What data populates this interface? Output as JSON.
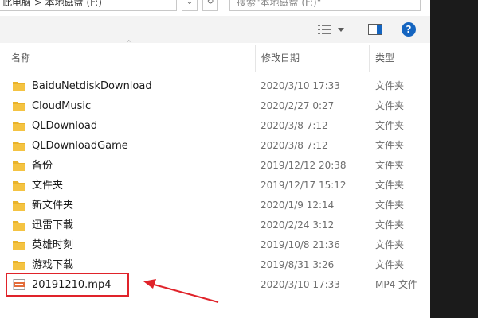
{
  "address": {
    "path": "此电脑 > 本地磁盘 (F:)"
  },
  "search": {
    "placeholder": "搜索\"本地磁盘 (F:)\""
  },
  "toolbar": {
    "help_label": "?"
  },
  "columns": {
    "name": "名称",
    "date": "修改日期",
    "type": "类型"
  },
  "icons": {
    "folder": "folder-icon",
    "file": "mp4-file-icon",
    "view": "view-details-icon",
    "preview": "preview-pane-icon",
    "help": "help-icon"
  },
  "colors": {
    "folder": "#f4c342",
    "accent": "#1565c0",
    "highlight": "#e0232a"
  },
  "files": [
    {
      "name": "BaiduNetdiskDownload",
      "date": "2020/3/10 17:33",
      "type": "文件夹",
      "kind": "folder"
    },
    {
      "name": "CloudMusic",
      "date": "2020/2/27 0:27",
      "type": "文件夹",
      "kind": "folder"
    },
    {
      "name": "QLDownload",
      "date": "2020/3/8 7:12",
      "type": "文件夹",
      "kind": "folder"
    },
    {
      "name": "QLDownloadGame",
      "date": "2020/3/8 7:12",
      "type": "文件夹",
      "kind": "folder"
    },
    {
      "name": "备份",
      "date": "2019/12/12 20:38",
      "type": "文件夹",
      "kind": "folder"
    },
    {
      "name": "文件夹",
      "date": "2019/12/17 15:12",
      "type": "文件夹",
      "kind": "folder"
    },
    {
      "name": "新文件夹",
      "date": "2020/1/9 12:14",
      "type": "文件夹",
      "kind": "folder"
    },
    {
      "name": "迅雷下载",
      "date": "2020/2/24 3:12",
      "type": "文件夹",
      "kind": "folder"
    },
    {
      "name": "英雄时刻",
      "date": "2019/10/8 21:36",
      "type": "文件夹",
      "kind": "folder"
    },
    {
      "name": "游戏下载",
      "date": "2019/8/31 3:26",
      "type": "文件夹",
      "kind": "folder"
    },
    {
      "name": "20191210.mp4",
      "date": "2020/3/10 17:33",
      "type": "MP4 文件",
      "kind": "file"
    }
  ]
}
